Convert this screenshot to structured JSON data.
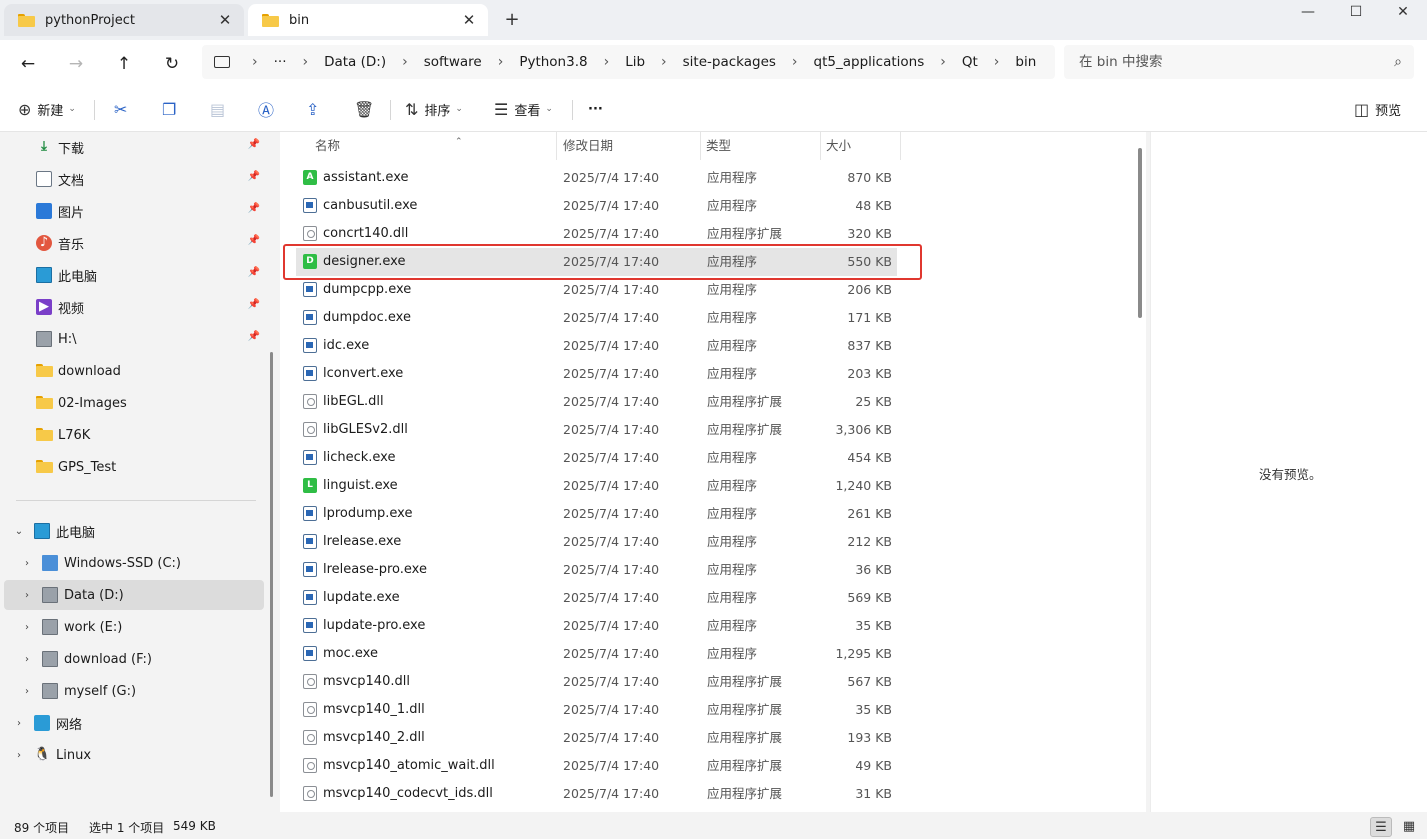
{
  "tabs": [
    {
      "title": "pythonProject",
      "icon": "folder-icon",
      "active": false
    },
    {
      "title": "bin",
      "icon": "folder-icon",
      "active": true
    }
  ],
  "window_controls": {
    "minimize": "—",
    "maximize": "☐",
    "close": "✕"
  },
  "nav": {
    "back": "←",
    "forward": "→",
    "up": "↑",
    "refresh": "↻"
  },
  "breadcrumb": [
    "Data (D:)",
    "software",
    "Python3.8",
    "Lib",
    "site-packages",
    "qt5_applications",
    "Qt",
    "bin"
  ],
  "breadcrumb_more": "···",
  "search": {
    "placeholder": "在 bin 中搜索"
  },
  "toolbar": {
    "new_label": "新建",
    "sort_label": "排序",
    "view_label": "查看",
    "more_label": "···",
    "preview_label": "预览"
  },
  "sidebar": {
    "quick_access": [
      {
        "label": "下载",
        "icon": "download-icon",
        "pinned": true
      },
      {
        "label": "文档",
        "icon": "document-icon",
        "pinned": true
      },
      {
        "label": "图片",
        "icon": "picture-icon",
        "pinned": true
      },
      {
        "label": "音乐",
        "icon": "music-icon",
        "pinned": true
      },
      {
        "label": "此电脑",
        "icon": "computer-icon",
        "pinned": true
      },
      {
        "label": "视频",
        "icon": "video-icon",
        "pinned": true
      },
      {
        "label": "H:\\",
        "icon": "drive-icon",
        "pinned": true
      },
      {
        "label": "download",
        "icon": "folder-icon",
        "pinned": false
      },
      {
        "label": "02-Images",
        "icon": "folder-icon",
        "pinned": false
      },
      {
        "label": "L76K",
        "icon": "folder-icon",
        "pinned": false
      },
      {
        "label": "GPS_Test",
        "icon": "folder-icon",
        "pinned": false
      }
    ],
    "this_pc": {
      "label": "此电脑",
      "expanded": true
    },
    "drives": [
      {
        "label": "Windows-SSD (C:)",
        "icon": "windows-drive-icon",
        "selected": false
      },
      {
        "label": "Data (D:)",
        "icon": "drive-icon",
        "selected": true
      },
      {
        "label": "work (E:)",
        "icon": "drive-icon",
        "selected": false
      },
      {
        "label": "download (F:)",
        "icon": "drive-icon",
        "selected": false
      },
      {
        "label": "myself (G:)",
        "icon": "drive-icon",
        "selected": false
      }
    ],
    "network": {
      "label": "网络"
    },
    "linux": {
      "label": "Linux"
    }
  },
  "columns": {
    "name": "名称",
    "date": "修改日期",
    "type": "类型",
    "size": "大小"
  },
  "files": [
    {
      "name": "assistant.exe",
      "date": "2025/7/4 17:40",
      "type": "应用程序",
      "size": "870 KB",
      "icon": "qt-app-icon",
      "badge": "A"
    },
    {
      "name": "canbusutil.exe",
      "date": "2025/7/4 17:40",
      "type": "应用程序",
      "size": "48 KB",
      "icon": "exe-icon"
    },
    {
      "name": "concrt140.dll",
      "date": "2025/7/4 17:40",
      "type": "应用程序扩展",
      "size": "320 KB",
      "icon": "dll-icon"
    },
    {
      "name": "designer.exe",
      "date": "2025/7/4 17:40",
      "type": "应用程序",
      "size": "550 KB",
      "icon": "qt-app-icon",
      "badge": "D",
      "selected": true
    },
    {
      "name": "dumpcpp.exe",
      "date": "2025/7/4 17:40",
      "type": "应用程序",
      "size": "206 KB",
      "icon": "exe-icon"
    },
    {
      "name": "dumpdoc.exe",
      "date": "2025/7/4 17:40",
      "type": "应用程序",
      "size": "171 KB",
      "icon": "exe-icon"
    },
    {
      "name": "idc.exe",
      "date": "2025/7/4 17:40",
      "type": "应用程序",
      "size": "837 KB",
      "icon": "exe-icon"
    },
    {
      "name": "lconvert.exe",
      "date": "2025/7/4 17:40",
      "type": "应用程序",
      "size": "203 KB",
      "icon": "exe-icon"
    },
    {
      "name": "libEGL.dll",
      "date": "2025/7/4 17:40",
      "type": "应用程序扩展",
      "size": "25 KB",
      "icon": "dll-icon"
    },
    {
      "name": "libGLESv2.dll",
      "date": "2025/7/4 17:40",
      "type": "应用程序扩展",
      "size": "3,306 KB",
      "icon": "dll-icon"
    },
    {
      "name": "licheck.exe",
      "date": "2025/7/4 17:40",
      "type": "应用程序",
      "size": "454 KB",
      "icon": "exe-icon"
    },
    {
      "name": "linguist.exe",
      "date": "2025/7/4 17:40",
      "type": "应用程序",
      "size": "1,240 KB",
      "icon": "qt-app-icon",
      "badge": "L"
    },
    {
      "name": "lprodump.exe",
      "date": "2025/7/4 17:40",
      "type": "应用程序",
      "size": "261 KB",
      "icon": "exe-icon"
    },
    {
      "name": "lrelease.exe",
      "date": "2025/7/4 17:40",
      "type": "应用程序",
      "size": "212 KB",
      "icon": "exe-icon"
    },
    {
      "name": "lrelease-pro.exe",
      "date": "2025/7/4 17:40",
      "type": "应用程序",
      "size": "36 KB",
      "icon": "exe-icon"
    },
    {
      "name": "lupdate.exe",
      "date": "2025/7/4 17:40",
      "type": "应用程序",
      "size": "569 KB",
      "icon": "exe-icon"
    },
    {
      "name": "lupdate-pro.exe",
      "date": "2025/7/4 17:40",
      "type": "应用程序",
      "size": "35 KB",
      "icon": "exe-icon"
    },
    {
      "name": "moc.exe",
      "date": "2025/7/4 17:40",
      "type": "应用程序",
      "size": "1,295 KB",
      "icon": "exe-icon"
    },
    {
      "name": "msvcp140.dll",
      "date": "2025/7/4 17:40",
      "type": "应用程序扩展",
      "size": "567 KB",
      "icon": "dll-icon"
    },
    {
      "name": "msvcp140_1.dll",
      "date": "2025/7/4 17:40",
      "type": "应用程序扩展",
      "size": "35 KB",
      "icon": "dll-icon"
    },
    {
      "name": "msvcp140_2.dll",
      "date": "2025/7/4 17:40",
      "type": "应用程序扩展",
      "size": "193 KB",
      "icon": "dll-icon"
    },
    {
      "name": "msvcp140_atomic_wait.dll",
      "date": "2025/7/4 17:40",
      "type": "应用程序扩展",
      "size": "49 KB",
      "icon": "dll-icon"
    },
    {
      "name": "msvcp140_codecvt_ids.dll",
      "date": "2025/7/4 17:40",
      "type": "应用程序扩展",
      "size": "31 KB",
      "icon": "dll-icon"
    }
  ],
  "preview": {
    "message": "没有预览。"
  },
  "status": {
    "item_count": "89 个项目",
    "selection": "选中 1 个项目",
    "selection_size": "549 KB"
  },
  "colors": {
    "highlight_border": "#e0372f",
    "selected_row": "#e5e5e5",
    "accent": "#2b63c6"
  }
}
